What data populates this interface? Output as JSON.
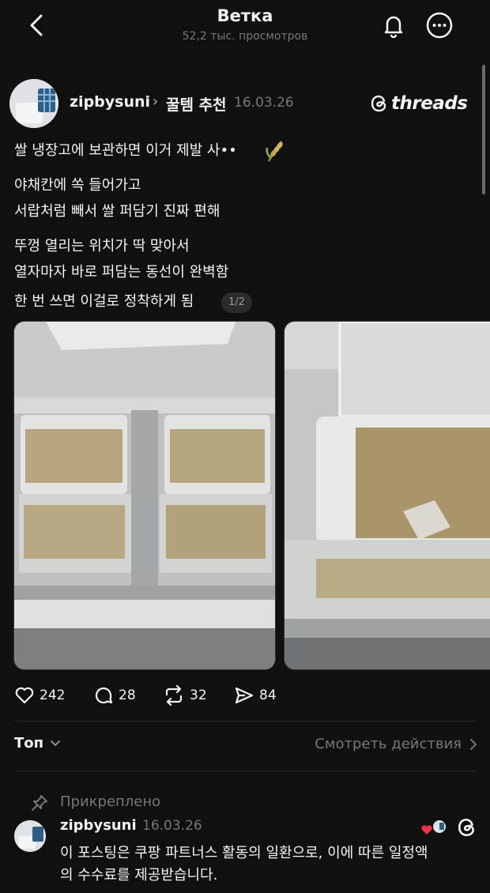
{
  "header": {
    "title": "Ветка",
    "views": "52,2 тыс. просмотров",
    "icons": [
      "back-icon",
      "bell-icon",
      "more-icon"
    ]
  },
  "post": {
    "username": "zipbysuni",
    "topic": "꿀템 추천",
    "date": "16.03.26",
    "brand": "threads",
    "lines": [
      "쌀 냉장고에 보관하면 이거 제발 사••",
      "야채칸에 쏙 들어가고",
      "서랍처럼 빼서 쌀 퍼담기 진짜 편해",
      "뚜껑 열리는 위치가 딱 맞아서",
      "열자마자 바로 퍼담는 동선이 완벽함",
      "한 번 쓰면 이걸로 정착하게 됨"
    ],
    "emoji": "rice-plant-icon",
    "image_counter": "1/2",
    "actions": {
      "likes": "242",
      "comments": "28",
      "reposts": "32",
      "shares": "84"
    }
  },
  "sort": {
    "label": "Топ",
    "view_activity": "Смотреть действия"
  },
  "pinned_comment": {
    "pinned_label": "Прикреплено",
    "username": "zipbysuni",
    "date": "16.03.26",
    "text_line1": "이 포스팅은 쿠팡 파트너스 활동의 일환으로, 이에 따른 일정액",
    "text_line2": "의 수수료를 제공받습니다."
  },
  "colors": {
    "background": "#101010",
    "text": "#f3f5f7",
    "secondary": "#777777",
    "like_red": "#ff3040"
  }
}
